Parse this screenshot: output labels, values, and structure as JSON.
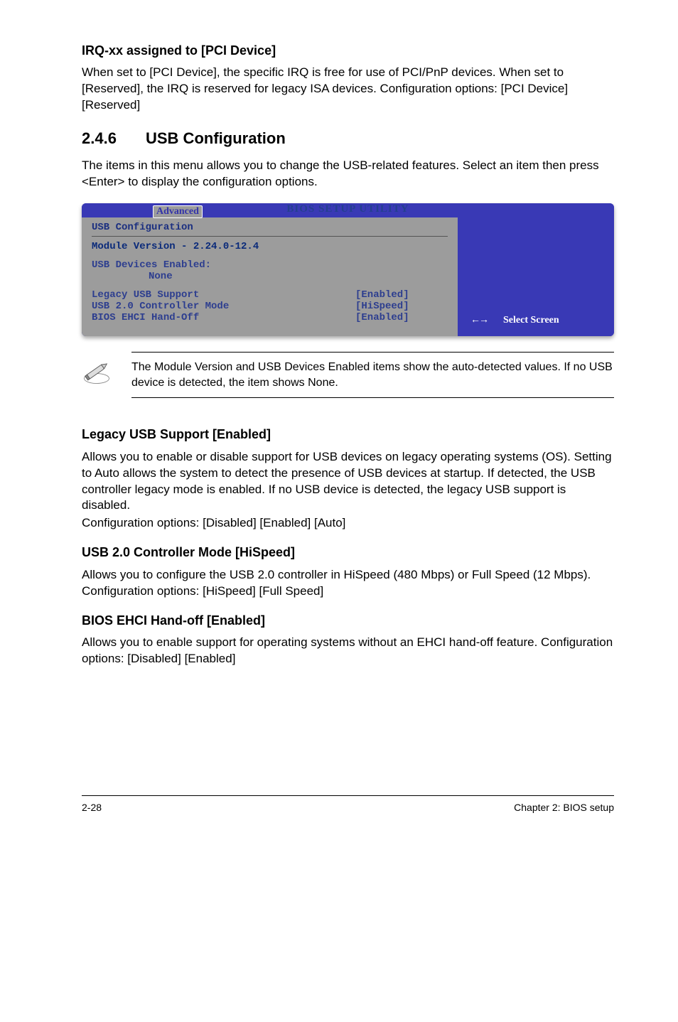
{
  "section_irq": {
    "heading": "IRQ-xx assigned to [PCI Device]",
    "body": "When set to [PCI Device], the specific IRQ is free for use of PCI/PnP devices. When set to [Reserved], the IRQ is reserved for legacy ISA devices. Configuration options: [PCI Device] [Reserved]"
  },
  "section_usb": {
    "number": "2.4.6",
    "title": "USB Configuration",
    "intro": "The items in this menu allows you to change the USB-related features. Select an item then press <Enter> to display the configuration options."
  },
  "bios": {
    "utility_title": "BIOS SETUP UTILITY",
    "tab": "Advanced",
    "panel_title": "USB Configuration",
    "module_version": "Module Version - 2.24.0-12.4",
    "devices_heading": "USB Devices Enabled:",
    "devices_value": "None",
    "rows": [
      {
        "k": "Legacy USB Support",
        "v": "[Enabled]"
      },
      {
        "k": "USB 2.0 Controller Mode",
        "v": "[HiSpeed]"
      },
      {
        "k": "BIOS EHCI Hand-Off",
        "v": "[Enabled]"
      }
    ],
    "hint_arrows": "←→",
    "hint_text": "Select Screen"
  },
  "note": {
    "text": "The Module Version and USB Devices Enabled items show the auto-detected values. If no USB device is detected, the item shows None."
  },
  "section_legacy": {
    "heading": "Legacy USB Support [Enabled]",
    "body": "Allows you to enable or disable support for USB devices on legacy operating systems (OS). Setting to Auto allows the system to detect the presence of USB devices at startup. If detected, the USB controller legacy mode is enabled. If no USB device is detected, the legacy USB support is disabled.",
    "body2": "Configuration options: [Disabled] [Enabled] [Auto]"
  },
  "section_mode": {
    "heading": "USB 2.0 Controller Mode [HiSpeed]",
    "body": "Allows you to configure the USB 2.0 controller in HiSpeed (480 Mbps) or Full Speed (12 Mbps). Configuration options: [HiSpeed] [Full Speed]"
  },
  "section_ehci": {
    "heading": "BIOS EHCI Hand-off [Enabled]",
    "body": "Allows you to enable support for operating systems without an EHCI hand-off feature. Configuration options: [Disabled] [Enabled]"
  },
  "footer": {
    "left": "2-28",
    "right": "Chapter 2: BIOS setup"
  }
}
